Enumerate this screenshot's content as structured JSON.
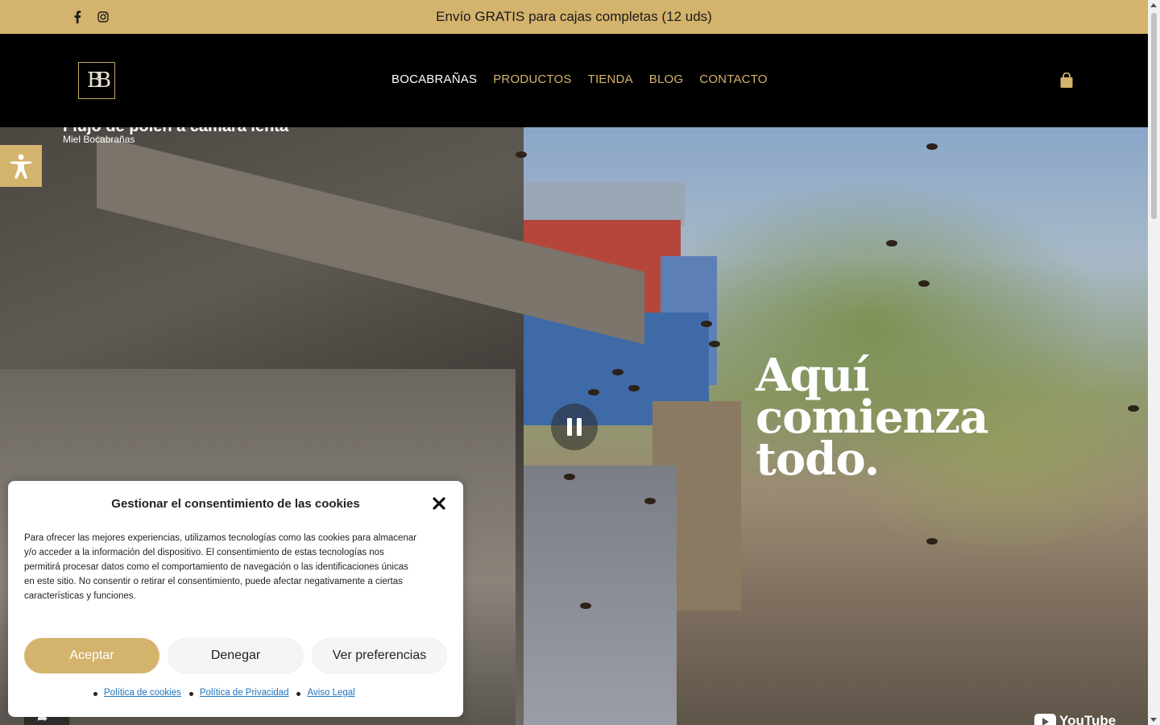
{
  "topbar": {
    "announcement": "Envío GRATIS para cajas completas (12 uds)",
    "social": [
      {
        "name": "facebook-icon"
      },
      {
        "name": "instagram-icon"
      }
    ],
    "background": "#d4b36c"
  },
  "header": {
    "logo_text": "B",
    "nav": [
      {
        "label": "BOCABRAÑAS",
        "active": true
      },
      {
        "label": "PRODUCTOS",
        "active": false
      },
      {
        "label": "TIENDA",
        "active": false
      },
      {
        "label": "BLOG",
        "active": false
      },
      {
        "label": "CONTACTO",
        "active": false
      }
    ],
    "cart_icon": "shopping-bag-icon",
    "accent": "#d4b36c"
  },
  "hero": {
    "video_title": "Flujo de polen a cámara lenta",
    "video_channel": "Miel Bocabrañas",
    "headline": "Aquí comienza todo.",
    "youtube_label": "YouTube",
    "pause_icon": "pause-icon",
    "share_icon": "share-icon"
  },
  "accessibility": {
    "icon": "accessibility-icon"
  },
  "cookie": {
    "title": "Gestionar el consentimiento de las cookies",
    "message": "Para ofrecer las mejores experiencias, utilizamos tecnologías como las cookies para almacenar y/o acceder a la información del dispositivo. El consentimiento de estas tecnologías nos permitirá procesar datos como el comportamiento de navegación o las identificaciones únicas en este sitio. No consentir o retirar el consentimiento, puede afectar negativamente a ciertas características y funciones.",
    "accept_label": "Aceptar",
    "deny_label": "Denegar",
    "prefs_label": "Ver preferencias",
    "links": [
      "Política de cookies",
      "Política de Privacidad",
      "Aviso Legal"
    ],
    "close_icon": "close-icon"
  }
}
